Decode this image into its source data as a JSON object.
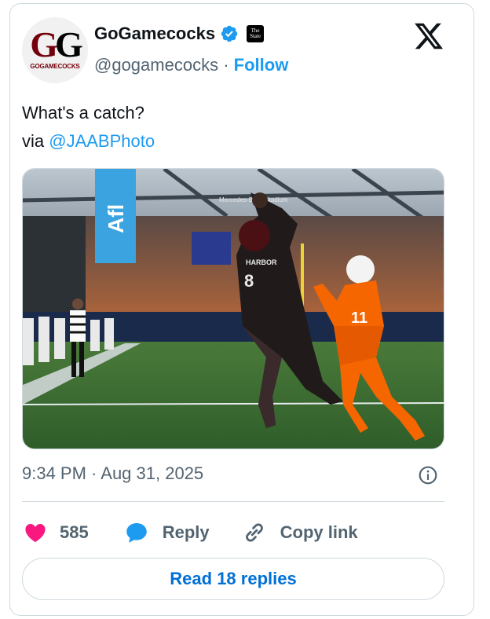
{
  "author": {
    "avatar_text_1": "G",
    "avatar_text_2": "G",
    "avatar_sub": "GOGAMECOCKS",
    "display_name": "GoGamecocks",
    "handle": "@gogamecocks",
    "separator": "·",
    "follow_label": "Follow",
    "affiliate_badge": "The State"
  },
  "tweet": {
    "line1": "What's a catch?",
    "via_label": "via",
    "mention": "@JAABPhoto"
  },
  "media": {
    "banner_text": "Afl",
    "stadium_sign": "Mercedes-Benz Stadium",
    "player1_name": "HARBOR",
    "player1_number": "8",
    "player2_number": "11"
  },
  "meta": {
    "timestamp": "9:34 PM · Aug 31, 2025"
  },
  "actions": {
    "like_count": "585",
    "reply_label": "Reply",
    "copy_label": "Copy link",
    "read_replies_label": "Read 18 replies"
  },
  "colors": {
    "like": "#f91880",
    "reply": "#1d9bf0",
    "link": "#1d9bf0",
    "verified": "#1d9bf0",
    "gamecock_garnet": "#73000a",
    "virginia_orange": "#f56600"
  },
  "icons": [
    "verified-badge-icon",
    "x-logo-icon",
    "info-icon",
    "heart-icon",
    "reply-bubble-icon",
    "link-icon"
  ]
}
